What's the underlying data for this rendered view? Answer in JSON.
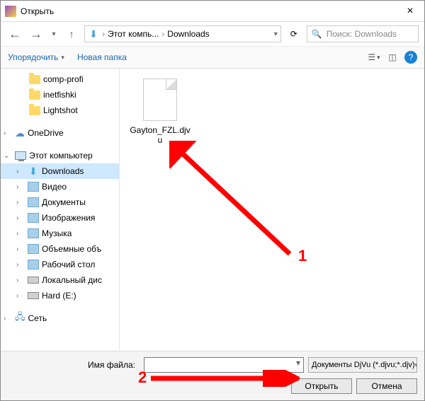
{
  "title": "Открыть",
  "breadcrumb": {
    "item1": "Этот компь...",
    "item2": "Downloads"
  },
  "search": {
    "placeholder": "Поиск: Downloads"
  },
  "toolbar": {
    "organize": "Упорядочить",
    "newfolder": "Новая папка"
  },
  "sidebar": {
    "f1": "comp-profi",
    "f2": "inetfishki",
    "f3": "Lightshot",
    "onedrive": "OneDrive",
    "thispc": "Этот компьютер",
    "downloads": "Downloads",
    "video": "Видео",
    "docs": "Документы",
    "images": "Изображения",
    "music": "Музыка",
    "objects": "Объемные объ",
    "desktop": "Рабочий стол",
    "localdisk": "Локальный дис",
    "harde": "Hard (E:)",
    "network": "Сеть"
  },
  "file": {
    "name": "Gayton_FZL.djvu"
  },
  "bottom": {
    "fname_label": "Имя файла:",
    "fname_value": "",
    "filter": "Документы DjVu (*.djvu;*.djv)",
    "open": "Открыть",
    "cancel": "Отмена"
  },
  "annot": {
    "one": "1",
    "two": "2"
  }
}
